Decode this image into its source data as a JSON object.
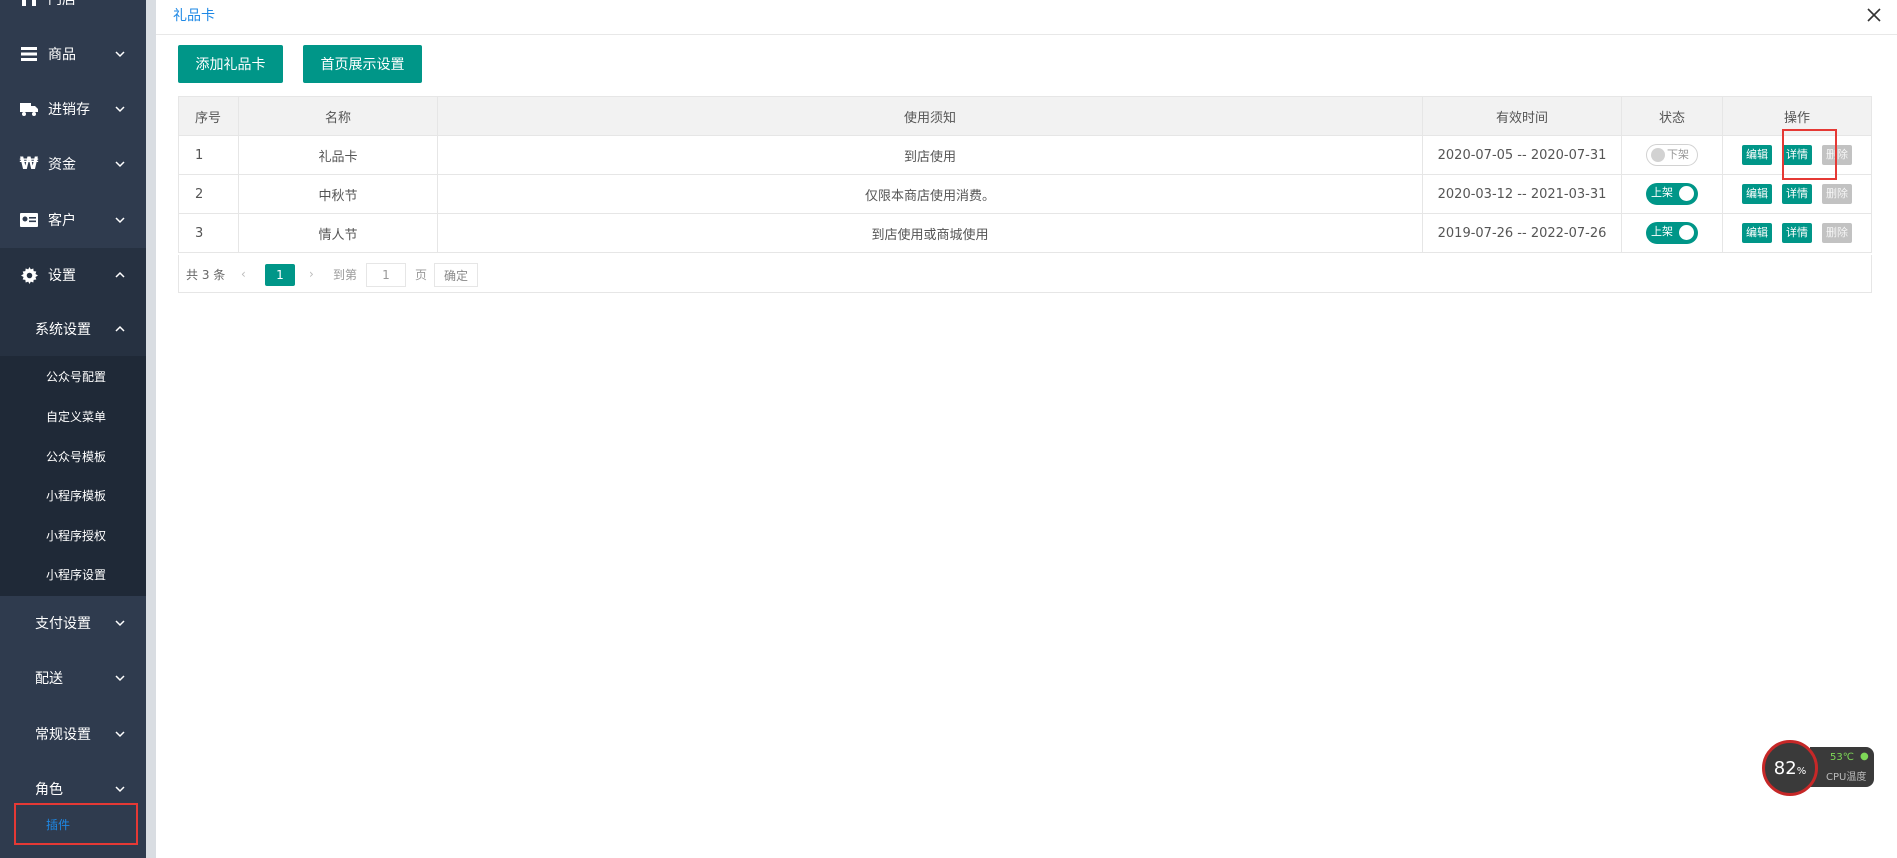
{
  "sidebar": {
    "top_item": "门店",
    "items": [
      {
        "label": "商品",
        "icon": "menu-icon"
      },
      {
        "label": "进销存",
        "icon": "truck-icon"
      },
      {
        "label": "资金",
        "icon": "won-icon"
      },
      {
        "label": "客户",
        "icon": "id-card-icon"
      },
      {
        "label": "设置",
        "icon": "gear-icon"
      }
    ],
    "system_settings": "系统设置",
    "sub_items": [
      "公众号配置",
      "自定义菜单",
      "公众号模板",
      "小程序模板",
      "小程序授权",
      "小程序设置"
    ],
    "lower_items": [
      "支付设置",
      "配送",
      "常规设置",
      "角色"
    ],
    "plugin": "插件"
  },
  "panel": {
    "title": "礼品卡",
    "add_button": "添加礼品卡",
    "home_display_button": "首页展示设置"
  },
  "table": {
    "headers": [
      "序号",
      "名称",
      "使用须知",
      "有效时间",
      "状态",
      "操作"
    ],
    "rows": [
      {
        "seq": "1",
        "name": "礼品卡",
        "notice": "到店使用",
        "valid": "2020-07-05 -- 2020-07-31",
        "status": "下架",
        "on": false
      },
      {
        "seq": "2",
        "name": "中秋节",
        "notice": "仅限本商店使用消费。",
        "valid": "2020-03-12 -- 2021-03-31",
        "status": "上架",
        "on": true
      },
      {
        "seq": "3",
        "name": "情人节",
        "notice": "到店使用或商城使用",
        "valid": "2019-07-26 -- 2022-07-26",
        "status": "上架",
        "on": true
      }
    ],
    "actions": {
      "edit": "编辑",
      "detail": "详情",
      "delete": "删除"
    }
  },
  "pagination": {
    "total": "共 3 条",
    "current_page": "1",
    "goto_label": "到第",
    "input_value": "1",
    "page_unit": "页",
    "confirm": "确定"
  },
  "cpu_widget": {
    "usage_number": "82",
    "usage_unit": "%",
    "temperature": "53℃",
    "label": "CPU温度"
  },
  "colors": {
    "primary": "#009688",
    "sidebar_bg": "#2f3b4e",
    "highlight": "#e53935",
    "title_blue": "#1e88e5"
  }
}
